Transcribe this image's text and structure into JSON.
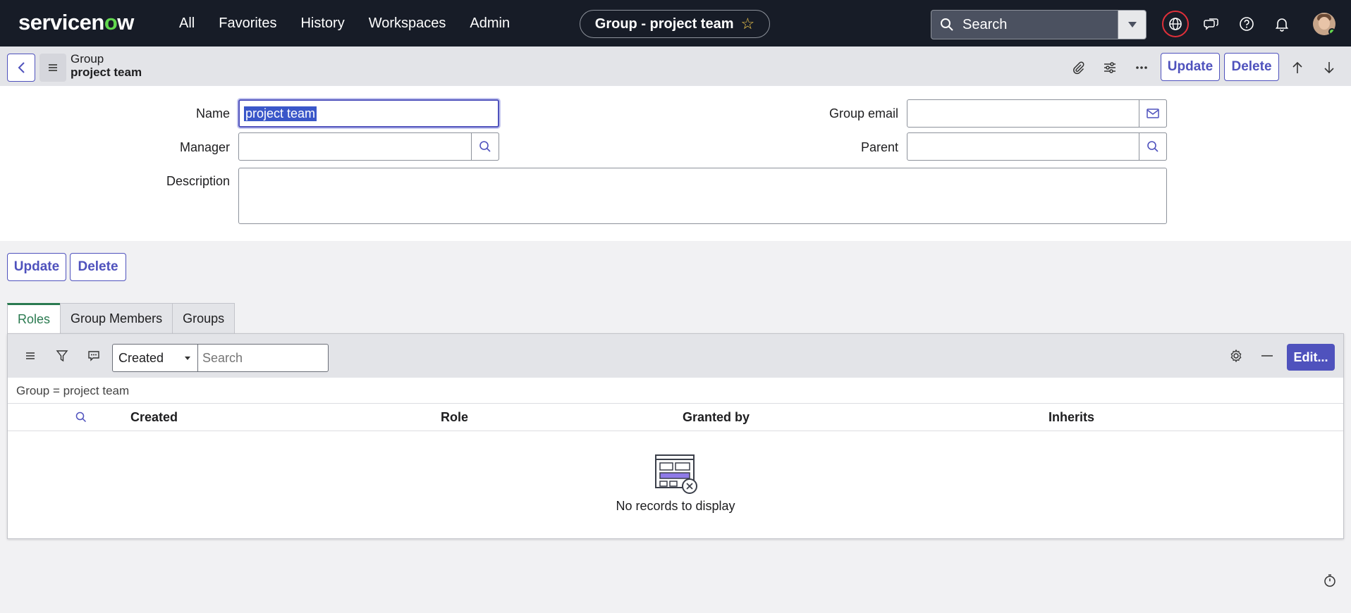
{
  "app": {
    "logo_text_a": "servicen",
    "logo_text_o": "o",
    "logo_text_b": "w"
  },
  "nav": {
    "links": [
      "All",
      "Favorites",
      "History",
      "Workspaces",
      "Admin"
    ],
    "record_title": "Group - project team",
    "search_label": "Search"
  },
  "record_header": {
    "type": "Group",
    "name": "project team",
    "update_label": "Update",
    "delete_label": "Delete"
  },
  "form": {
    "name_label": "Name",
    "name_value": "project team",
    "manager_label": "Manager",
    "manager_value": "",
    "description_label": "Description",
    "description_value": "",
    "group_email_label": "Group email",
    "group_email_value": "",
    "parent_label": "Parent",
    "parent_value": ""
  },
  "form_actions": {
    "update_label": "Update",
    "delete_label": "Delete"
  },
  "related_tabs": [
    {
      "label": "Roles",
      "active": true
    },
    {
      "label": "Group Members",
      "active": false
    },
    {
      "label": "Groups",
      "active": false
    }
  ],
  "related_list": {
    "filter_field": "Created",
    "search_placeholder": "Search",
    "edit_label": "Edit...",
    "breadcrumb": "Group = project team",
    "columns": [
      "Created",
      "Role",
      "Granted by",
      "Inherits"
    ],
    "empty_message": "No records to display"
  },
  "colors": {
    "nav_bg": "#171c27",
    "accent": "#4f52bd",
    "brand_green": "#62d84e",
    "active_tab": "#2a7a50"
  }
}
